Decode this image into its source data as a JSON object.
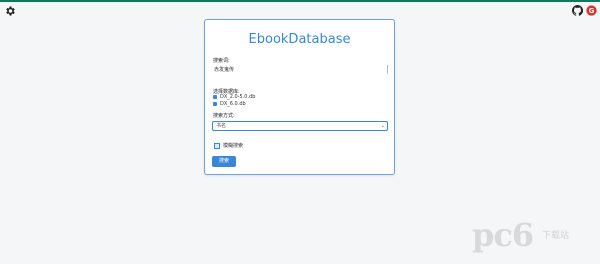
{
  "header": {
    "settings_icon": "gear-icon",
    "github_icon": "github-icon",
    "extension_icon": "extension-icon",
    "accent_color": "#0f7a5a"
  },
  "form": {
    "title": "EbookDatabase",
    "keyword_label": "搜索词:",
    "keyword_value": "赤发鬼传",
    "databases_label": "选择数据库:",
    "databases": [
      {
        "label": "DX_2.0-5.0.db",
        "checked": true
      },
      {
        "label": "DX_6.0.db",
        "checked": true
      }
    ],
    "method_label": "搜索方式:",
    "method_value": "书名",
    "fuzzy_label": "模糊搜索",
    "fuzzy_checked": true,
    "submit_label": "搜索",
    "accent_color": "#3b86d6"
  },
  "watermark": {
    "brand": "pc6",
    "sub": "下载站"
  }
}
